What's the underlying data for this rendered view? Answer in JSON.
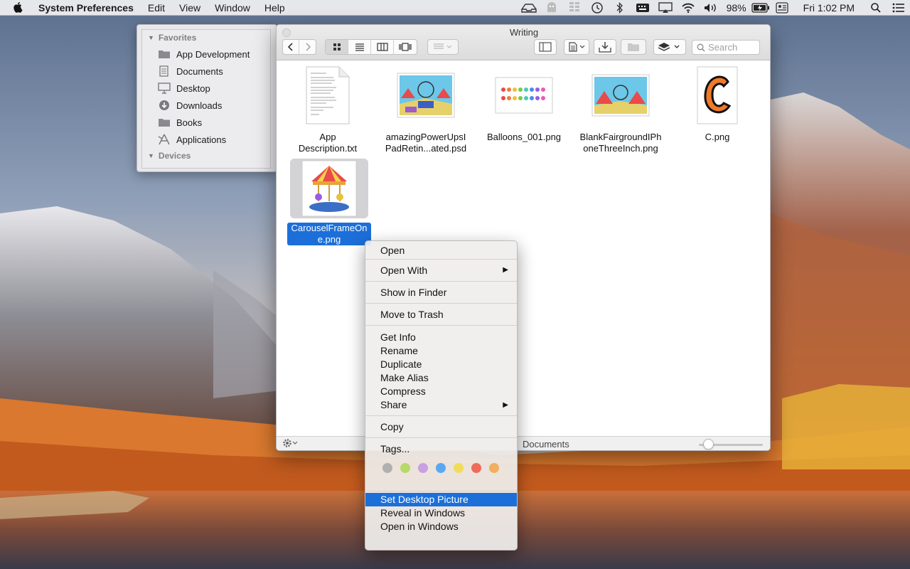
{
  "menubar": {
    "app_name": "System Preferences",
    "menus": [
      "Edit",
      "View",
      "Window",
      "Help"
    ],
    "battery": "98%",
    "clock": "Fri 1:02 PM",
    "icons": [
      "cloud-tray-icon",
      "ghost-icon",
      "grid-icon",
      "time-machine-icon",
      "bluetooth-icon",
      "keyboard-icon",
      "airplay-icon",
      "wifi-icon",
      "volume-icon",
      "battery-icon",
      "user-icon",
      "search-icon",
      "list-icon"
    ]
  },
  "sidebar": {
    "favorites_label": "Favorites",
    "devices_label": "Devices",
    "items": [
      {
        "label": "App Development",
        "icon": "folder-icon"
      },
      {
        "label": "Documents",
        "icon": "documents-icon"
      },
      {
        "label": "Desktop",
        "icon": "desktop-icon"
      },
      {
        "label": "Downloads",
        "icon": "downloads-icon"
      },
      {
        "label": "Books",
        "icon": "folder-icon"
      },
      {
        "label": "Applications",
        "icon": "applications-icon"
      }
    ]
  },
  "finder": {
    "title": "Writing",
    "search_placeholder": "Search",
    "status_text": "Documents",
    "files": [
      {
        "name": "App Description.txt"
      },
      {
        "name": "amazingPowerUpsIPadRetin...ated.psd"
      },
      {
        "name": "Balloons_001.png"
      },
      {
        "name": "BlankFairgroundIPhoneThreeInch.png"
      },
      {
        "name": "C.png"
      },
      {
        "name": "CarouselFrameOne.png"
      }
    ],
    "file_name_lines": {
      "f0": [
        "App",
        "Description.txt"
      ],
      "f1": [
        "amazingPowerUpsI",
        "PadRetin...ated.psd"
      ],
      "f2": [
        "Balloons_001.png"
      ],
      "f3": [
        "BlankFairgroundIPh",
        "oneThreeInch.png"
      ],
      "f4": [
        "C.png"
      ],
      "f5": [
        "CarouselFrameOn",
        "e.png"
      ]
    }
  },
  "context_menu": {
    "open": "Open",
    "open_with": "Open With",
    "show_in_finder": "Show in Finder",
    "move_to_trash": "Move to Trash",
    "get_info": "Get Info",
    "rename": "Rename",
    "duplicate": "Duplicate",
    "make_alias": "Make Alias",
    "compress": "Compress",
    "share": "Share",
    "copy": "Copy",
    "tags": "Tags...",
    "tag_colors": [
      "#b0b0b0",
      "#b8d86a",
      "#c9a0e0",
      "#5aa8f0",
      "#f0dc5a",
      "#f06a5a",
      "#f0b060"
    ],
    "set_desktop_picture": "Set Desktop Picture",
    "reveal_in_windows": "Reveal in Windows",
    "open_in_windows": "Open in Windows"
  },
  "colors": {
    "selection": "#1c6fd9",
    "menu_bg": "#f0eeec"
  }
}
